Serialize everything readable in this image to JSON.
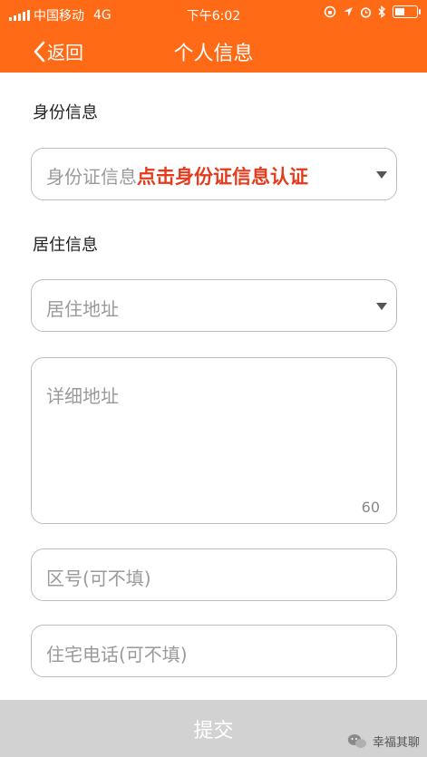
{
  "status_bar": {
    "carrier": "中国移动",
    "network": "4G",
    "time": "下午6:02"
  },
  "nav": {
    "back_label": "返回",
    "title": "个人信息"
  },
  "identity_section": {
    "label": "身份信息",
    "select_placeholder": "身份证信息",
    "select_action": "点击身份证信息认证"
  },
  "residence_section": {
    "label": "居住信息",
    "address_placeholder": "居住地址",
    "detail_placeholder": "详细地址",
    "detail_counter": "60",
    "area_code_placeholder": "区号(可不填)",
    "home_phone_placeholder": "住宅电话(可不填)"
  },
  "submit_label": "提交",
  "watermark_text": "幸福其聊",
  "colors": {
    "brand_orange": "#ff6a16",
    "action_red": "#e43b1c",
    "submit_disabled": "#d2d2d2"
  }
}
